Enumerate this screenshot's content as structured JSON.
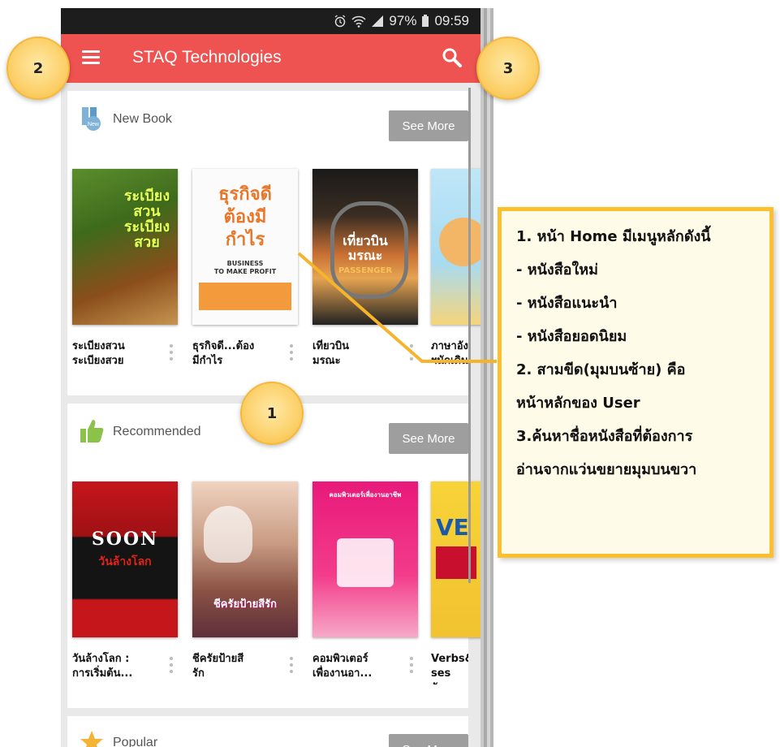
{
  "status_bar": {
    "icons": [
      "alarm-icon",
      "wifi-icon",
      "signal-icon"
    ],
    "battery": "97%",
    "time": "09:59"
  },
  "app_bar": {
    "title": "STAQ Technologies",
    "menu_icon": "hamburger-icon",
    "search_icon": "search-icon",
    "background": "#ef5351"
  },
  "sections": [
    {
      "title": "New Book",
      "icon": "new-book-icon",
      "see_more": "See More",
      "books": [
        {
          "caption": "ระเบียงสวน\nระเบียงสวย",
          "cover_text": "ระเบียง\nสวน\nระเบียง\nสวย"
        },
        {
          "caption": "ธุรกิจดี...ต้อง\nมีกำไร",
          "cover_text": "ธุรกิจดี\nต้องมี\nกำไร",
          "cover_sub": "BUSINESS\nTO MAKE PROFIT"
        },
        {
          "caption": "เที่ยวบิน\nมรณะ",
          "cover_text": "เที่ยวบิน\nมรณะ",
          "cover_sub": "PASSENGER"
        },
        {
          "caption": "ภาษาอัง\nฯนักเดินท"
        }
      ]
    },
    {
      "title": "Recommended",
      "icon": "thumbs-up-icon",
      "see_more": "See More",
      "books": [
        {
          "caption": "วันล้างโลก :\nการเริ่มต้น...",
          "cover_text": "SOON",
          "cover_sub": "วันล้างโลก"
        },
        {
          "caption": "ชีครัยป้ายสี\nรัก",
          "cover_text": "ชีครัยป้ายสีรัก"
        },
        {
          "caption": "คอมพิวเตอร์\nเพื่องานอา...",
          "cover_text": "คอมพิวเตอร์เพื่องานอาชีพ"
        },
        {
          "caption": "Verbs&\nses อังก",
          "cover_text": "VE"
        }
      ]
    },
    {
      "title": "Popular",
      "icon": "star-icon",
      "see_more": "See More"
    }
  ],
  "callouts": [
    "1",
    "2",
    "3"
  ],
  "note_lines": [
    "1. หน้า Home มีเมนูหลักดังนี้",
    "- หนังสือใหม่",
    "- หนังสือแนะนำ",
    "- หนังสือยอดนิยม",
    "2. สามขีด(มุมบนซ้าย) คือ",
    "หน้าหลักของ User",
    "3.ค้นหาชื่อหนังสือที่ต้องการ",
    "อ่านจากแว่นขยายมุมบนขวา"
  ]
}
